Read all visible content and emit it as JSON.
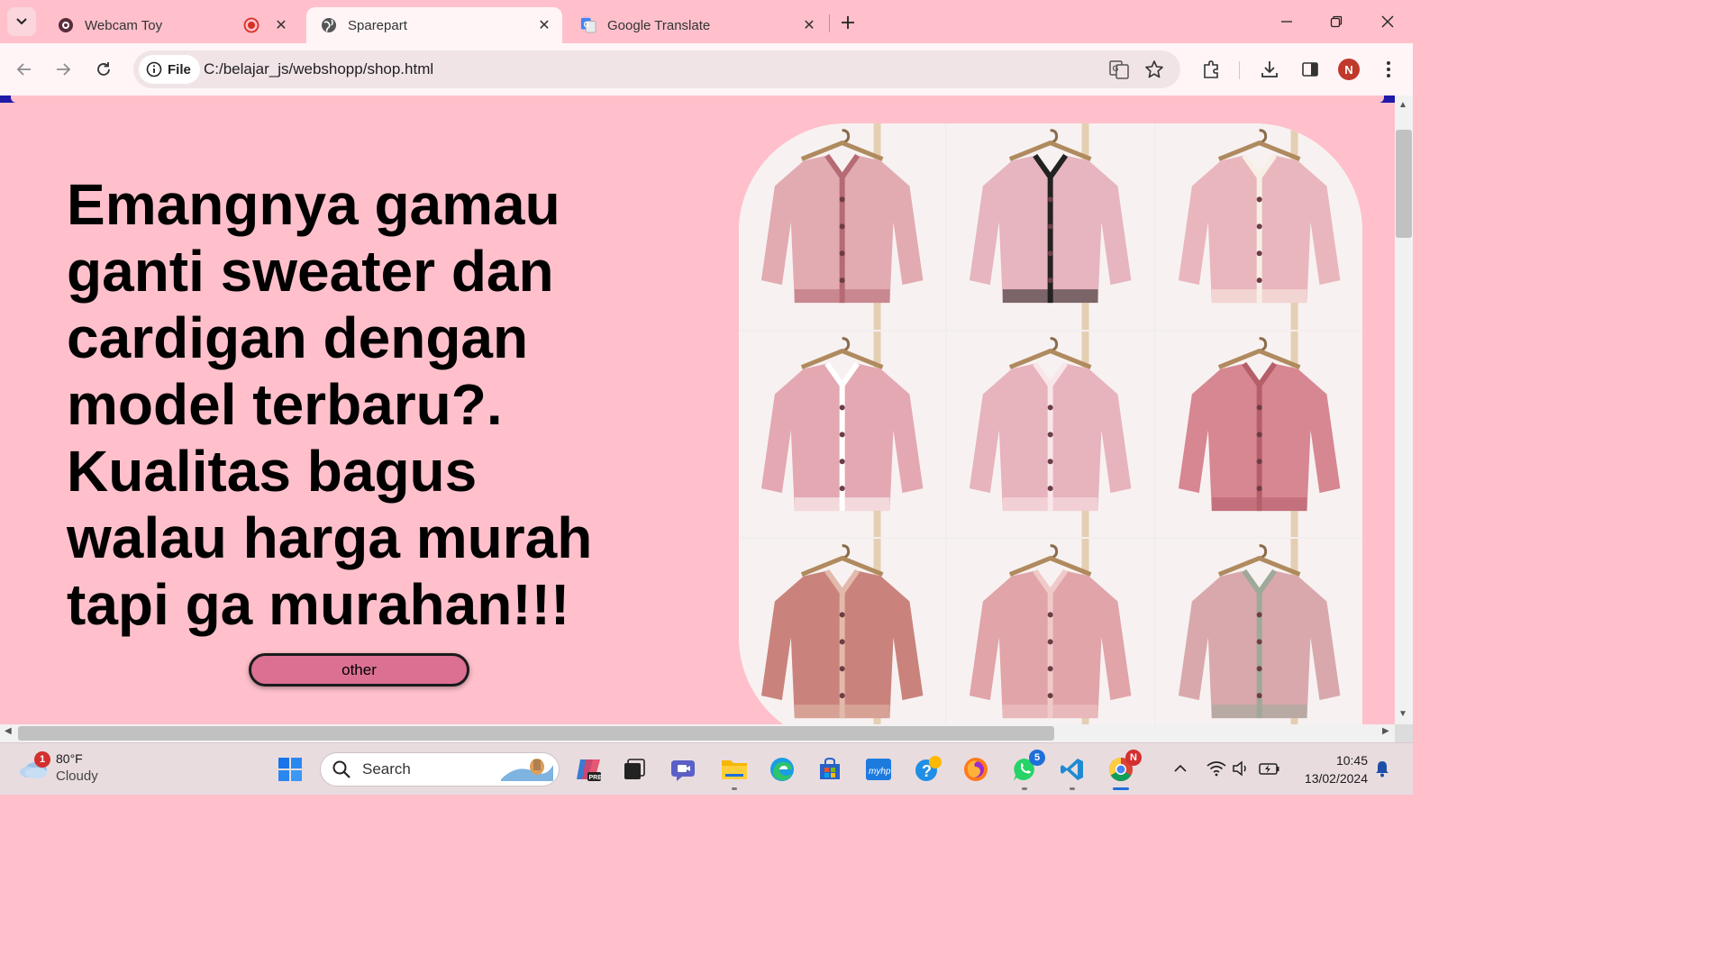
{
  "browser": {
    "tabs": [
      {
        "title": "Webcam Toy",
        "favicon": "webcam-toy-icon",
        "recording": true,
        "active": false
      },
      {
        "title": "Sparepart",
        "favicon": "globe-icon",
        "active": true
      },
      {
        "title": "Google Translate",
        "favicon": "google-translate-icon",
        "active": false
      }
    ],
    "address": {
      "chip_label": "File",
      "url": "C:/belajar_js/webshopp/shop.html"
    },
    "profile_initial": "N"
  },
  "page": {
    "headline": "Emangnya gamau ganti sweater dan cardigan dengan model terbaru?. Kualitas bagus walau harga murah tapi ga murahan!!!",
    "button_label": "other",
    "gallery": {
      "items": [
        {
          "main": "#e2aab1",
          "accent": "#b56a74"
        },
        {
          "main": "#e6b5bf",
          "accent": "#222222"
        },
        {
          "main": "#eab6bd",
          "accent": "#f7efe6"
        },
        {
          "main": "#e4a8b2",
          "accent": "#ffffff"
        },
        {
          "main": "#e7b3bc",
          "accent": "#f9e6ea"
        },
        {
          "main": "#d78792",
          "accent": "#b55f6b"
        },
        {
          "main": "#c9837c",
          "accent": "#e2b9aa"
        },
        {
          "main": "#e0a4a9",
          "accent": "#f0c9c9"
        },
        {
          "main": "#d9a8ad",
          "accent": "#9fa99a"
        }
      ]
    }
  },
  "taskbar": {
    "weather": {
      "temp": "80°F",
      "condition": "Cloudy",
      "badge": "1"
    },
    "search_label": "Search",
    "whatsapp_badge": "5",
    "chrome_badge": "N",
    "clock": {
      "time": "10:45",
      "date": "13/02/2024"
    }
  },
  "colors": {
    "page_bg": "#ffc0cb",
    "button_bg": "#db7093",
    "chrome_bg": "#ffc0cb"
  }
}
